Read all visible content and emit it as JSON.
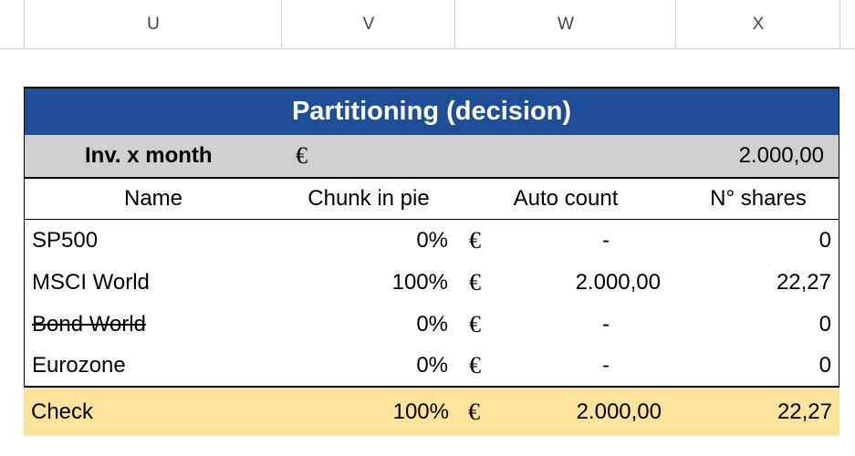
{
  "columns": [
    "U",
    "V",
    "W",
    "X"
  ],
  "table": {
    "title": "Partitioning (decision)",
    "inv_label": "Inv. x month",
    "inv_currency": "€",
    "inv_value": "2.000,00",
    "headers": [
      "Name",
      "Chunk in pie",
      "Auto count",
      "N° shares"
    ],
    "rows": [
      {
        "name": "SP500",
        "chunk": "0%",
        "currency": "€",
        "auto": "-",
        "shares": "0"
      },
      {
        "name": "MSCI World",
        "chunk": "100%",
        "currency": "€",
        "auto": "2.000,00",
        "shares": "22,27"
      },
      {
        "name": "Bond World",
        "chunk": "0%",
        "currency": "€",
        "auto": "-",
        "shares": "0",
        "struck": true
      },
      {
        "name": "Eurozone",
        "chunk": "0%",
        "currency": "€",
        "auto": "-",
        "shares": "0"
      }
    ],
    "check": {
      "name": "Check",
      "chunk": "100%",
      "currency": "€",
      "auto": "2.000,00",
      "shares": "22,27"
    }
  },
  "colors": {
    "title_bg": "#1f4e98",
    "inv_bg": "#d0d0d0",
    "check_bg": "#fde49a"
  }
}
